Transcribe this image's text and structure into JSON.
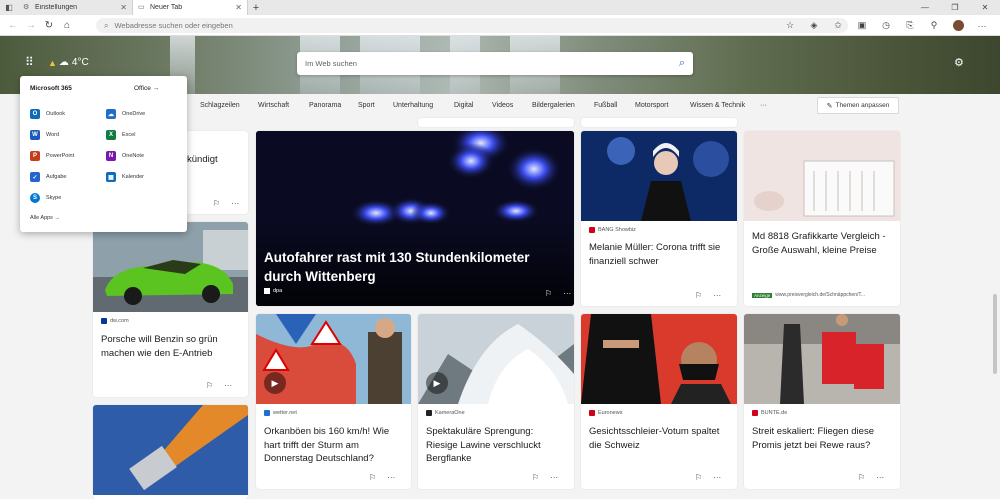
{
  "tabs": [
    {
      "label": "Einstellungen",
      "icon": "gear-icon"
    },
    {
      "label": "Neuer Tab",
      "icon": "page-icon"
    }
  ],
  "address": {
    "placeholder": "Webadresse suchen oder eingeben"
  },
  "weather": {
    "temp": "4°C"
  },
  "search": {
    "placeholder": "Im Web suchen"
  },
  "m365": {
    "title": "Microsoft 365",
    "office": "Office",
    "apps": [
      {
        "label": "Outlook",
        "color": "#0f6cbd",
        "glyph": "O"
      },
      {
        "label": "OneDrive",
        "color": "#1f6fc6",
        "glyph": "☁"
      },
      {
        "label": "Word",
        "color": "#185abd",
        "glyph": "W"
      },
      {
        "label": "Excel",
        "color": "#107c41",
        "glyph": "X"
      },
      {
        "label": "PowerPoint",
        "color": "#c43e1c",
        "glyph": "P"
      },
      {
        "label": "OneNote",
        "color": "#7719aa",
        "glyph": "N"
      },
      {
        "label": "Aufgabe",
        "color": "#2564cf",
        "glyph": "✓"
      },
      {
        "label": "Kalender",
        "color": "#0f6cbd",
        "glyph": "▦"
      },
      {
        "label": "Skype",
        "color": "#0078d4",
        "glyph": "S"
      }
    ],
    "all_apps": "Alle Apps"
  },
  "categories": [
    "Schlagzeilen",
    "Wirtschaft",
    "Panorama",
    "Sport",
    "Unterhaltung",
    "Digital",
    "Videos",
    "Bildergalerien",
    "Fußball",
    "Motorsport",
    "Wissen & Technik",
    "···"
  ],
  "customize": "Themen anpassen",
  "cards": {
    "c1_title": "kündigt",
    "feature": {
      "title": "Autofahrer rast mit 130 Stundenkilometer durch Wittenberg",
      "source": "dpa"
    },
    "melanie": {
      "source": "BANG Showbiz",
      "title": "Melanie Müller: Corona trifft sie finanziell schwer"
    },
    "md8818": {
      "title": "Md 8818 Grafikkarte Vergleich - Große Auswahl, kleine Preise",
      "ad_badge": "Anzeige",
      "ad_url": "www.preisvergleich.de/Schnäppchen/T..."
    },
    "porsche": {
      "source": "dw.com",
      "title": "Porsche will Benzin so grün machen wie den E-Antrieb"
    },
    "orkan": {
      "source": "wetter.net",
      "title": "Orkanböen bis 160 km/h! Wie hart trifft der Sturm am Donnerstag Deutschland?"
    },
    "lawine": {
      "source": "KameraOne",
      "title": "Spektakuläre Sprengung: Riesige Lawine verschluckt Bergflanke"
    },
    "schleier": {
      "source": "Euronews",
      "title": "Gesichtsschleier-Votum spaltet die Schweiz"
    },
    "rewe": {
      "source": "BUNTE.de",
      "title": "Streit eskaliert: Fliegen diese Promis jetzt bei Rewe raus?"
    }
  },
  "colors": {
    "accent": "#2a6ad6"
  }
}
